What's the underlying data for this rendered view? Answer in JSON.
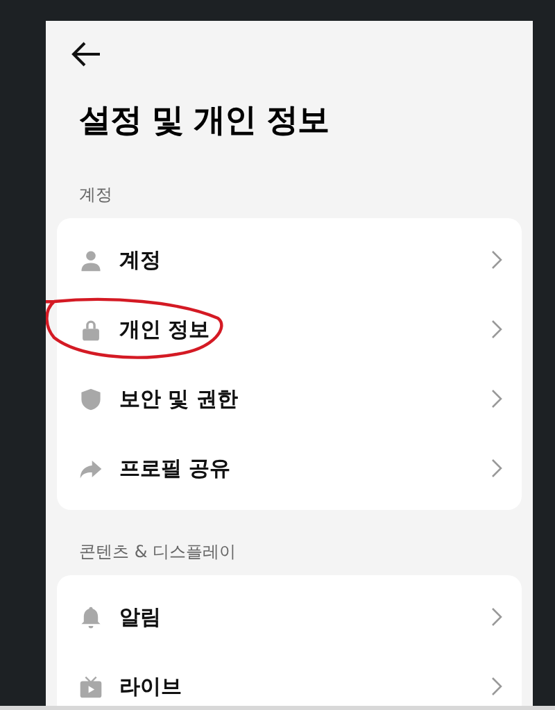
{
  "header": {
    "title": "설정 및 개인 정보"
  },
  "sections": [
    {
      "label": "계정",
      "items": [
        {
          "label": "계정",
          "kind": "person",
          "annotated": false
        },
        {
          "label": "개인 정보",
          "kind": "lock",
          "annotated": true
        },
        {
          "label": "보안 및 권한",
          "kind": "shield",
          "annotated": false
        },
        {
          "label": "프로필 공유",
          "kind": "share",
          "annotated": false
        }
      ]
    },
    {
      "label": "콘텐츠 & 디스플레이",
      "items": [
        {
          "label": "알림",
          "kind": "bell",
          "annotated": false
        },
        {
          "label": "라이브",
          "kind": "tv",
          "annotated": false
        }
      ]
    }
  ]
}
